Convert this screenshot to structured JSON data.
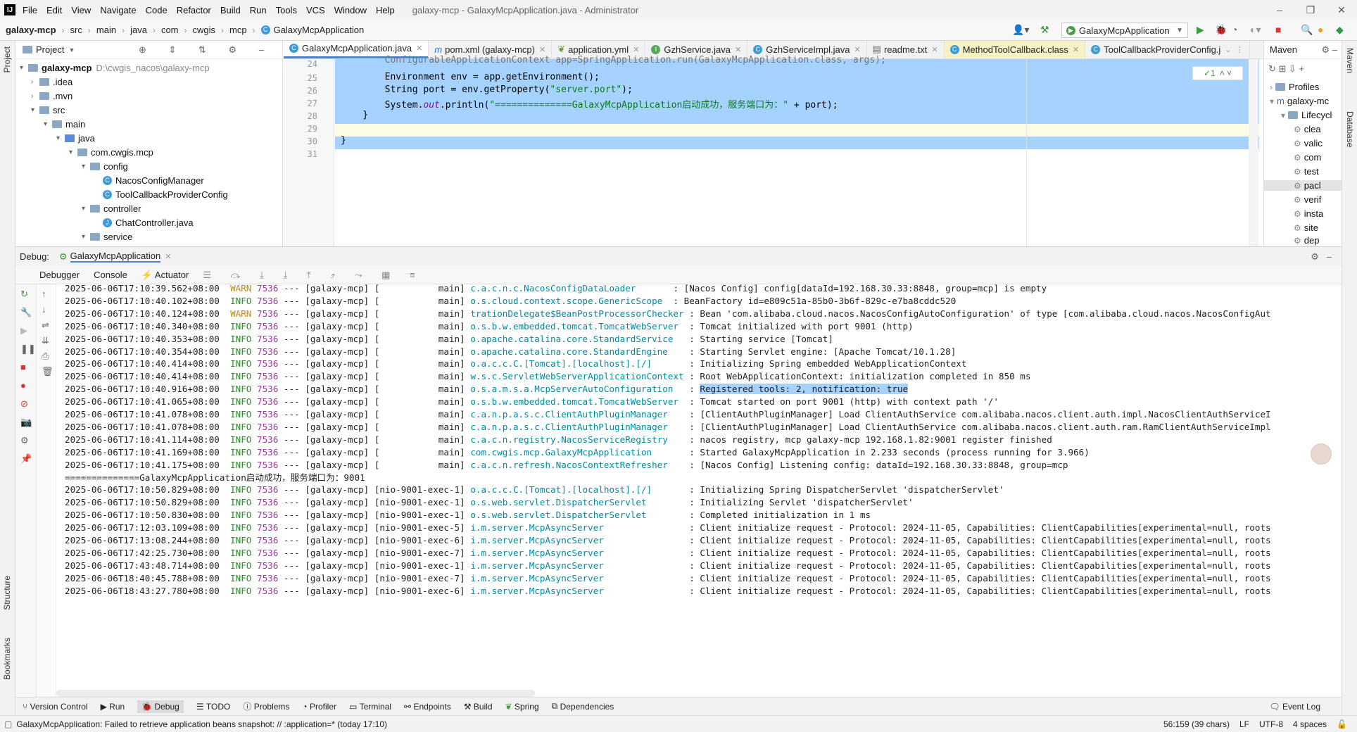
{
  "menubar": {
    "items": [
      "File",
      "Edit",
      "View",
      "Navigate",
      "Code",
      "Refactor",
      "Build",
      "Run",
      "Tools",
      "VCS",
      "Window",
      "Help"
    ],
    "window_title": "galaxy-mcp - GalaxyMcpApplication.java - Administrator"
  },
  "navbar": {
    "crumbs": [
      "galaxy-mcp",
      "src",
      "main",
      "java",
      "com",
      "cwgis",
      "mcp",
      "GalaxyMcpApplication"
    ],
    "run_config": "GalaxyMcpApplication"
  },
  "project": {
    "header": "Project",
    "root": "galaxy-mcp",
    "root_path": "D:\\cwgis_nacos\\galaxy-mcp",
    "items": [
      {
        "label": ".idea"
      },
      {
        "label": ".mvn"
      },
      {
        "label": "src"
      },
      {
        "label": "main"
      },
      {
        "label": "java"
      },
      {
        "label": "com.cwgis.mcp"
      },
      {
        "label": "config"
      },
      {
        "label": "NacosConfigManager"
      },
      {
        "label": "ToolCallbackProviderConfig"
      },
      {
        "label": "controller"
      },
      {
        "label": "ChatController.java"
      },
      {
        "label": "service"
      }
    ]
  },
  "editor": {
    "tabs": [
      {
        "label": "GalaxyMcpApplication.java",
        "active": true
      },
      {
        "label": "pom.xml (galaxy-mcp)"
      },
      {
        "label": "application.yml"
      },
      {
        "label": "GzhService.java"
      },
      {
        "label": "GzhServiceImpl.java"
      },
      {
        "label": "readme.txt"
      },
      {
        "label": "MethodToolCallback.class"
      },
      {
        "label": "ToolCallbackProviderConfig.j"
      }
    ],
    "line_numbers": [
      "24",
      "25",
      "26",
      "27",
      "28",
      "29",
      "30",
      "31"
    ],
    "lines": [
      "        ConfigurableApplicationContext app=SpringApplication.run(GalaxyMcpApplication.class, args);",
      "        Environment env = app.getEnvironment();",
      "        String port = env.getProperty(",
      "        System.",
      "    }",
      "",
      "}",
      ""
    ],
    "port_string": "\"server.port\"",
    "println_out": "out",
    "println_rest": ".println(",
    "println_string": "\"==============GalaxyMcpApplication启动成功，服务端口为：\"",
    "println_tail": " + port);",
    "paren_close": ");",
    "inspection": "✓1"
  },
  "maven": {
    "header": "Maven",
    "items": [
      "Profiles",
      "galaxy-mc",
      "Lifecycl",
      "clea",
      "valic",
      "com",
      "test",
      "pacl",
      "verif",
      "insta",
      "site",
      "dep"
    ]
  },
  "debug": {
    "label": "Debug:",
    "config": "GalaxyMcpApplication",
    "tabs": [
      "Debugger",
      "Console",
      "Actuator"
    ]
  },
  "console": {
    "lines": [
      {
        "ts": "2025-06-06T17:10:39.562+08:00",
        "lvl": "WARN",
        "pid": "7536",
        "mid": " --- [galaxy-mcp] [           main] ",
        "logger": "c.a.c.n.c.NacosConfigDataLoader      ",
        "msg": " : [Nacos Config] config[dataId=192.168.30.33:8848, group=mcp] is empty"
      },
      {
        "ts": "2025-06-06T17:10:40.102+08:00",
        "lvl": "INFO",
        "pid": "7536",
        "mid": " --- [galaxy-mcp] [           main] ",
        "logger": "o.s.cloud.context.scope.GenericScope ",
        "msg": " : BeanFactory id=e809c51a-85b0-3b6f-829c-e7ba8cddc520"
      },
      {
        "ts": "2025-06-06T17:10:40.124+08:00",
        "lvl": "WARN",
        "pid": "7536",
        "mid": " --- [galaxy-mcp] [           main] ",
        "logger": "trationDelegate$BeanPostProcessorChecker",
        "msg": " : Bean 'com.alibaba.cloud.nacos.NacosConfigAutoConfiguration' of type [com.alibaba.cloud.nacos.NacosConfigAut"
      },
      {
        "ts": "2025-06-06T17:10:40.340+08:00",
        "lvl": "INFO",
        "pid": "7536",
        "mid": " --- [galaxy-mcp] [           main] ",
        "logger": "o.s.b.w.embedded.tomcat.TomcatWebServer ",
        "msg": " : Tomcat initialized with port 9001 (http)"
      },
      {
        "ts": "2025-06-06T17:10:40.353+08:00",
        "lvl": "INFO",
        "pid": "7536",
        "mid": " --- [galaxy-mcp] [           main] ",
        "logger": "o.apache.catalina.core.StandardService  ",
        "msg": " : Starting service [Tomcat]"
      },
      {
        "ts": "2025-06-06T17:10:40.354+08:00",
        "lvl": "INFO",
        "pid": "7536",
        "mid": " --- [galaxy-mcp] [           main] ",
        "logger": "o.apache.catalina.core.StandardEngine   ",
        "msg": " : Starting Servlet engine: [Apache Tomcat/10.1.28]"
      },
      {
        "ts": "2025-06-06T17:10:40.414+08:00",
        "lvl": "INFO",
        "pid": "7536",
        "mid": " --- [galaxy-mcp] [           main] ",
        "logger": "o.a.c.c.C.[Tomcat].[localhost].[/]      ",
        "msg": " : Initializing Spring embedded WebApplicationContext"
      },
      {
        "ts": "2025-06-06T17:10:40.414+08:00",
        "lvl": "INFO",
        "pid": "7536",
        "mid": " --- [galaxy-mcp] [           main] ",
        "logger": "w.s.c.ServletWebServerApplicationContext",
        "msg": " : Root WebApplicationContext: initialization completed in 850 ms"
      },
      {
        "ts": "2025-06-06T17:10:40.916+08:00",
        "lvl": "INFO",
        "pid": "7536",
        "mid": " --- [galaxy-mcp] [           main] ",
        "logger": "o.s.a.m.s.a.McpServerAutoConfiguration  ",
        "msg": " : ",
        "hl": "Registered tools: 2, notification: true"
      },
      {
        "ts": "2025-06-06T17:10:41.065+08:00",
        "lvl": "INFO",
        "pid": "7536",
        "mid": " --- [galaxy-mcp] [           main] ",
        "logger": "o.s.b.w.embedded.tomcat.TomcatWebServer ",
        "msg": " : Tomcat started on port 9001 (http) with context path '/'"
      },
      {
        "ts": "2025-06-06T17:10:41.078+08:00",
        "lvl": "INFO",
        "pid": "7536",
        "mid": " --- [galaxy-mcp] [           main] ",
        "logger": "c.a.n.p.a.s.c.ClientAuthPluginManager   ",
        "msg": " : [ClientAuthPluginManager] Load ClientAuthService com.alibaba.nacos.client.auth.impl.NacosClientAuthServiceI"
      },
      {
        "ts": "2025-06-06T17:10:41.078+08:00",
        "lvl": "INFO",
        "pid": "7536",
        "mid": " --- [galaxy-mcp] [           main] ",
        "logger": "c.a.n.p.a.s.c.ClientAuthPluginManager   ",
        "msg": " : [ClientAuthPluginManager] Load ClientAuthService com.alibaba.nacos.client.auth.ram.RamClientAuthServiceImpl"
      },
      {
        "ts": "2025-06-06T17:10:41.114+08:00",
        "lvl": "INFO",
        "pid": "7536",
        "mid": " --- [galaxy-mcp] [           main] ",
        "logger": "c.a.c.n.registry.NacosServiceRegistry   ",
        "msg": " : nacos registry, mcp galaxy-mcp 192.168.1.82:9001 register finished"
      },
      {
        "ts": "2025-06-06T17:10:41.169+08:00",
        "lvl": "INFO",
        "pid": "7536",
        "mid": " --- [galaxy-mcp] [           main] ",
        "logger": "com.cwgis.mcp.GalaxyMcpApplication      ",
        "msg": " : Started GalaxyMcpApplication in 2.233 seconds (process running for 3.966)"
      },
      {
        "ts": "2025-06-06T17:10:41.175+08:00",
        "lvl": "INFO",
        "pid": "7536",
        "mid": " --- [galaxy-mcp] [           main] ",
        "logger": "c.a.c.n.refresh.NacosContextRefresher   ",
        "msg": " : [Nacos Config] Listening config: dataId=192.168.30.33:8848, group=mcp"
      },
      {
        "plain": "==============GalaxyMcpApplication启动成功，服务端口为：9001"
      },
      {
        "ts": "2025-06-06T17:10:50.829+08:00",
        "lvl": "INFO",
        "pid": "7536",
        "mid": " --- [galaxy-mcp] [nio-9001-exec-1] ",
        "logger": "o.a.c.c.C.[Tomcat].[localhost].[/]      ",
        "msg": " : Initializing Spring DispatcherServlet 'dispatcherServlet'"
      },
      {
        "ts": "2025-06-06T17:10:50.829+08:00",
        "lvl": "INFO",
        "pid": "7536",
        "mid": " --- [galaxy-mcp] [nio-9001-exec-1] ",
        "logger": "o.s.web.servlet.DispatcherServlet       ",
        "msg": " : Initializing Servlet 'dispatcherServlet'"
      },
      {
        "ts": "2025-06-06T17:10:50.830+08:00",
        "lvl": "INFO",
        "pid": "7536",
        "mid": " --- [galaxy-mcp] [nio-9001-exec-1] ",
        "logger": "o.s.web.servlet.DispatcherServlet       ",
        "msg": " : Completed initialization in 1 ms"
      },
      {
        "ts": "2025-06-06T17:12:03.109+08:00",
        "lvl": "INFO",
        "pid": "7536",
        "mid": " --- [galaxy-mcp] [nio-9001-exec-5] ",
        "logger": "i.m.server.McpAsyncServer               ",
        "msg": " : Client initialize request - Protocol: 2024-11-05, Capabilities: ClientCapabilities[experimental=null, roots"
      },
      {
        "ts": "2025-06-06T17:13:08.244+08:00",
        "lvl": "INFO",
        "pid": "7536",
        "mid": " --- [galaxy-mcp] [nio-9001-exec-6] ",
        "logger": "i.m.server.McpAsyncServer               ",
        "msg": " : Client initialize request - Protocol: 2024-11-05, Capabilities: ClientCapabilities[experimental=null, roots"
      },
      {
        "ts": "2025-06-06T17:42:25.730+08:00",
        "lvl": "INFO",
        "pid": "7536",
        "mid": " --- [galaxy-mcp] [nio-9001-exec-7] ",
        "logger": "i.m.server.McpAsyncServer               ",
        "msg": " : Client initialize request - Protocol: 2024-11-05, Capabilities: ClientCapabilities[experimental=null, roots"
      },
      {
        "ts": "2025-06-06T17:43:48.714+08:00",
        "lvl": "INFO",
        "pid": "7536",
        "mid": " --- [galaxy-mcp] [nio-9001-exec-1] ",
        "logger": "i.m.server.McpAsyncServer               ",
        "msg": " : Client initialize request - Protocol: 2024-11-05, Capabilities: ClientCapabilities[experimental=null, roots"
      },
      {
        "ts": "2025-06-06T18:40:45.788+08:00",
        "lvl": "INFO",
        "pid": "7536",
        "mid": " --- [galaxy-mcp] [nio-9001-exec-7] ",
        "logger": "i.m.server.McpAsyncServer               ",
        "msg": " : Client initialize request - Protocol: 2024-11-05, Capabilities: ClientCapabilities[experimental=null, roots"
      },
      {
        "ts": "2025-06-06T18:43:27.780+08:00",
        "lvl": "INFO",
        "pid": "7536",
        "mid": " --- [galaxy-mcp] [nio-9001-exec-6] ",
        "logger": "i.m.server.McpAsyncServer               ",
        "msg": " : Client initialize request - Protocol: 2024-11-05, Capabilities: ClientCapabilities[experimental=null, roots"
      }
    ]
  },
  "bottom_tools": {
    "items": [
      "Version Control",
      "Run",
      "Debug",
      "TODO",
      "Problems",
      "Profiler",
      "Terminal",
      "Endpoints",
      "Build",
      "Spring",
      "Dependencies"
    ],
    "event_log": "Event Log"
  },
  "left_strip": {
    "project": "Project",
    "structure": "Structure",
    "bookmarks": "Bookmarks"
  },
  "right_strip": {
    "maven": "Maven",
    "database": "Database"
  },
  "status": {
    "message": "GalaxyMcpApplication: Failed to retrieve application beans snapshot: // :application=* (today 17:10)",
    "position": "56:159 (39 chars)",
    "line_sep": "LF",
    "encoding": "UTF-8",
    "indent": "4 spaces"
  }
}
